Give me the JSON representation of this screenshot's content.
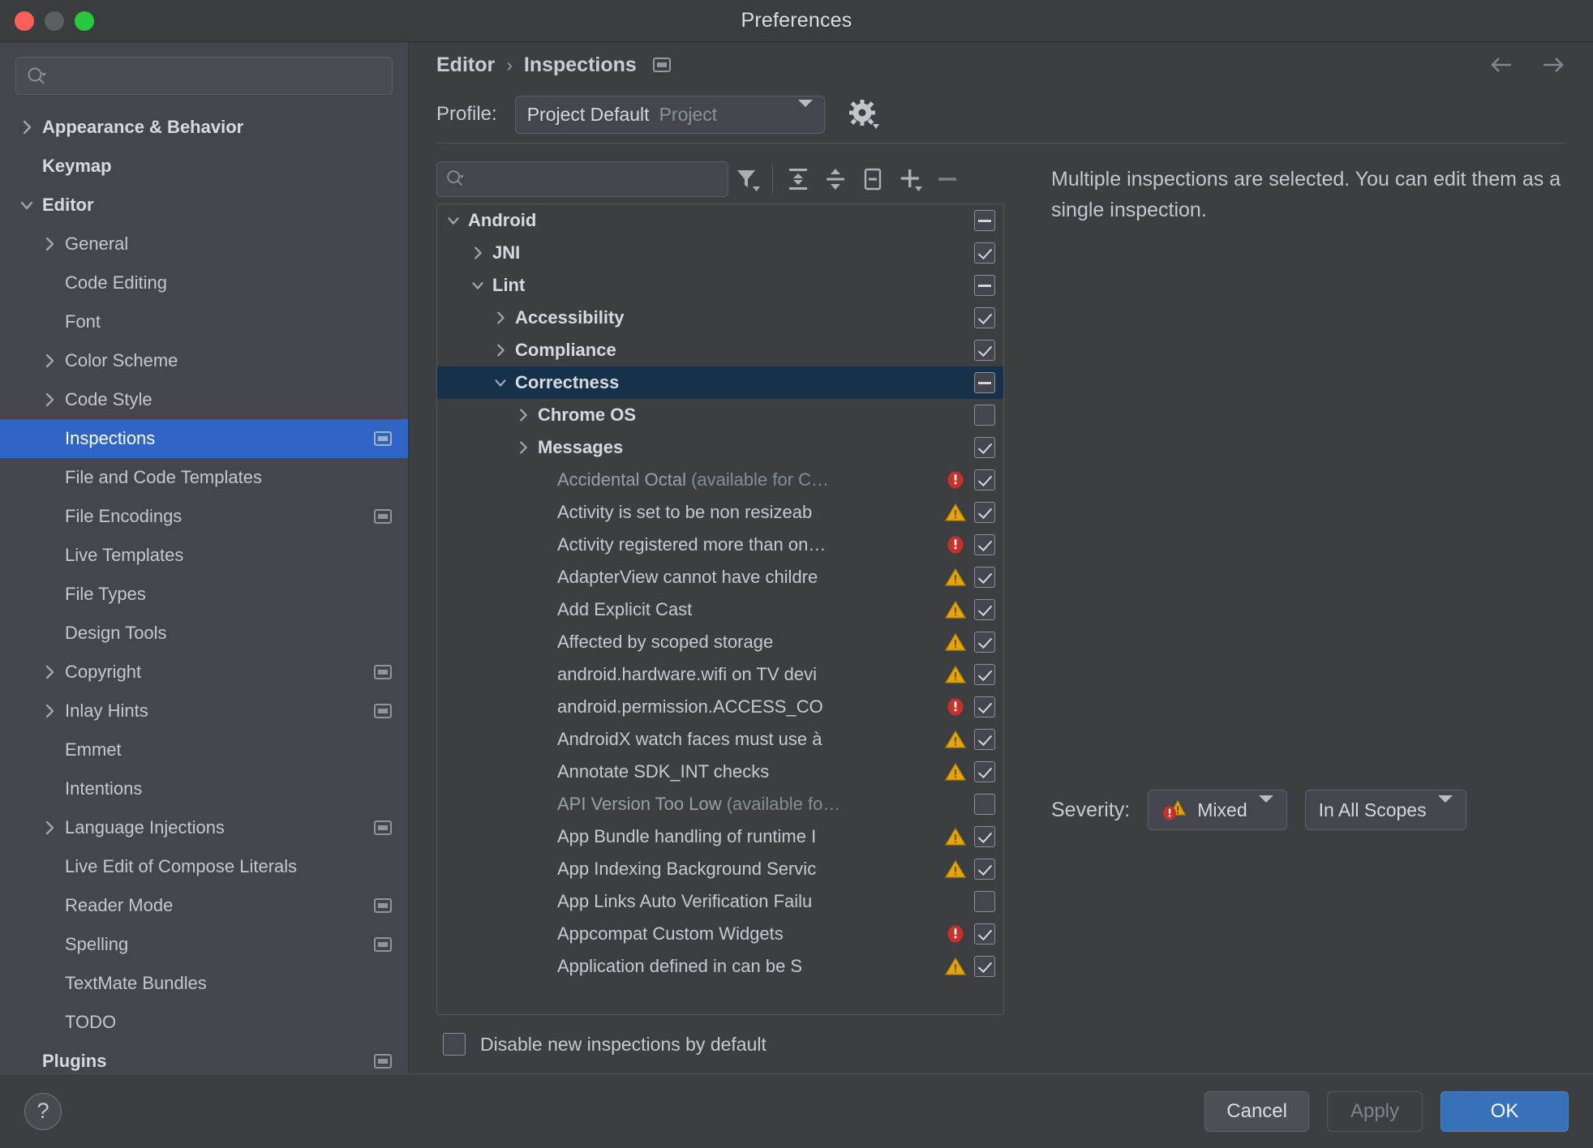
{
  "window": {
    "title": "Preferences",
    "traffic_lights": [
      "close-red",
      "minimize-yellow",
      "zoom-green"
    ]
  },
  "sidebar": {
    "search": {
      "value": "",
      "placeholder": ""
    },
    "items": [
      {
        "label": "Appearance & Behavior",
        "caret": "right",
        "level": 0,
        "bold": true,
        "badge": false,
        "selected": false
      },
      {
        "label": "Keymap",
        "caret": "none",
        "level": 0,
        "bold": true,
        "badge": false,
        "selected": false
      },
      {
        "label": "Editor",
        "caret": "down",
        "level": 0,
        "bold": true,
        "badge": false,
        "selected": false
      },
      {
        "label": "General",
        "caret": "right",
        "level": 1,
        "bold": false,
        "badge": false,
        "selected": false
      },
      {
        "label": "Code Editing",
        "caret": "none",
        "level": 1,
        "bold": false,
        "badge": false,
        "selected": false
      },
      {
        "label": "Font",
        "caret": "none",
        "level": 1,
        "bold": false,
        "badge": false,
        "selected": false
      },
      {
        "label": "Color Scheme",
        "caret": "right",
        "level": 1,
        "bold": false,
        "badge": false,
        "selected": false
      },
      {
        "label": "Code Style",
        "caret": "right",
        "level": 1,
        "bold": false,
        "badge": false,
        "selected": false
      },
      {
        "label": "Inspections",
        "caret": "none",
        "level": 1,
        "bold": false,
        "badge": true,
        "selected": true
      },
      {
        "label": "File and Code Templates",
        "caret": "none",
        "level": 1,
        "bold": false,
        "badge": false,
        "selected": false
      },
      {
        "label": "File Encodings",
        "caret": "none",
        "level": 1,
        "bold": false,
        "badge": true,
        "selected": false
      },
      {
        "label": "Live Templates",
        "caret": "none",
        "level": 1,
        "bold": false,
        "badge": false,
        "selected": false
      },
      {
        "label": "File Types",
        "caret": "none",
        "level": 1,
        "bold": false,
        "badge": false,
        "selected": false
      },
      {
        "label": "Design Tools",
        "caret": "none",
        "level": 1,
        "bold": false,
        "badge": false,
        "selected": false
      },
      {
        "label": "Copyright",
        "caret": "right",
        "level": 1,
        "bold": false,
        "badge": true,
        "selected": false
      },
      {
        "label": "Inlay Hints",
        "caret": "right",
        "level": 1,
        "bold": false,
        "badge": true,
        "selected": false
      },
      {
        "label": "Emmet",
        "caret": "none",
        "level": 1,
        "bold": false,
        "badge": false,
        "selected": false
      },
      {
        "label": "Intentions",
        "caret": "none",
        "level": 1,
        "bold": false,
        "badge": false,
        "selected": false
      },
      {
        "label": "Language Injections",
        "caret": "right",
        "level": 1,
        "bold": false,
        "badge": true,
        "selected": false
      },
      {
        "label": "Live Edit of Compose Literals",
        "caret": "none",
        "level": 1,
        "bold": false,
        "badge": false,
        "selected": false
      },
      {
        "label": "Reader Mode",
        "caret": "none",
        "level": 1,
        "bold": false,
        "badge": true,
        "selected": false
      },
      {
        "label": "Spelling",
        "caret": "none",
        "level": 1,
        "bold": false,
        "badge": true,
        "selected": false
      },
      {
        "label": "TextMate Bundles",
        "caret": "none",
        "level": 1,
        "bold": false,
        "badge": false,
        "selected": false
      },
      {
        "label": "TODO",
        "caret": "none",
        "level": 1,
        "bold": false,
        "badge": false,
        "selected": false
      },
      {
        "label": "Plugins",
        "caret": "none",
        "level": 0,
        "bold": true,
        "badge": true,
        "selected": false
      }
    ]
  },
  "header": {
    "breadcrumb": {
      "parent": "Editor",
      "separator": "›",
      "current": "Inspections"
    },
    "nav": {
      "back": "back-arrow",
      "forward": "forward-arrow"
    }
  },
  "profile": {
    "label": "Profile:",
    "value": "Project Default",
    "scope": "Project",
    "gear": "gear-icon"
  },
  "toolbar": {
    "search": {
      "value": "",
      "placeholder": ""
    },
    "buttons": [
      {
        "name": "filter-icon",
        "tooltip": "Filter inspections"
      },
      {
        "name": "expand-all-icon",
        "tooltip": "Expand All"
      },
      {
        "name": "collapse-all-icon",
        "tooltip": "Collapse All"
      },
      {
        "name": "reset-icon",
        "tooltip": "Reset to Defaults"
      },
      {
        "name": "add-icon",
        "tooltip": "Add"
      },
      {
        "name": "remove-icon",
        "tooltip": "Remove"
      }
    ]
  },
  "tree": {
    "rows": [
      {
        "label": "Android",
        "indent": 0,
        "caret": "down",
        "bold": true,
        "check": "partial",
        "severity": "none",
        "selected": false,
        "dim": false,
        "paren": ""
      },
      {
        "label": "JNI",
        "indent": 1,
        "caret": "right",
        "bold": true,
        "check": "checked",
        "severity": "none",
        "selected": false,
        "dim": false,
        "paren": ""
      },
      {
        "label": "Lint",
        "indent": 1,
        "caret": "down",
        "bold": true,
        "check": "partial",
        "severity": "none",
        "selected": false,
        "dim": false,
        "paren": ""
      },
      {
        "label": "Accessibility",
        "indent": 2,
        "caret": "right",
        "bold": true,
        "check": "checked",
        "severity": "none",
        "selected": false,
        "dim": false,
        "paren": ""
      },
      {
        "label": "Compliance",
        "indent": 2,
        "caret": "right",
        "bold": true,
        "check": "checked",
        "severity": "none",
        "selected": false,
        "dim": false,
        "paren": ""
      },
      {
        "label": "Correctness",
        "indent": 2,
        "caret": "down",
        "bold": true,
        "check": "partial",
        "severity": "none",
        "selected": true,
        "dim": false,
        "paren": ""
      },
      {
        "label": "Chrome OS",
        "indent": 3,
        "caret": "right",
        "bold": true,
        "check": "empty",
        "severity": "none",
        "selected": false,
        "dim": false,
        "paren": ""
      },
      {
        "label": "Messages",
        "indent": 3,
        "caret": "right",
        "bold": true,
        "check": "checked",
        "severity": "none",
        "selected": false,
        "dim": false,
        "paren": ""
      },
      {
        "label": "Accidental Octal",
        "indent": 4,
        "caret": "none",
        "bold": false,
        "check": "checked",
        "severity": "error",
        "selected": false,
        "dim": true,
        "paren": " (available for C…"
      },
      {
        "label": "Activity is set to be non resizeab",
        "indent": 4,
        "caret": "none",
        "bold": false,
        "check": "checked",
        "severity": "warning",
        "selected": false,
        "dim": false,
        "paren": ""
      },
      {
        "label": "Activity registered more than on…",
        "indent": 4,
        "caret": "none",
        "bold": false,
        "check": "checked",
        "severity": "error",
        "selected": false,
        "dim": false,
        "paren": ""
      },
      {
        "label": "AdapterView cannot have childre",
        "indent": 4,
        "caret": "none",
        "bold": false,
        "check": "checked",
        "severity": "warning",
        "selected": false,
        "dim": false,
        "paren": ""
      },
      {
        "label": "Add Explicit Cast",
        "indent": 4,
        "caret": "none",
        "bold": false,
        "check": "checked",
        "severity": "warning",
        "selected": false,
        "dim": false,
        "paren": ""
      },
      {
        "label": "Affected by scoped storage",
        "indent": 4,
        "caret": "none",
        "bold": false,
        "check": "checked",
        "severity": "warning",
        "selected": false,
        "dim": false,
        "paren": ""
      },
      {
        "label": "android.hardware.wifi on TV devi",
        "indent": 4,
        "caret": "none",
        "bold": false,
        "check": "checked",
        "severity": "warning",
        "selected": false,
        "dim": false,
        "paren": ""
      },
      {
        "label": "android.permission.ACCESS_CO",
        "indent": 4,
        "caret": "none",
        "bold": false,
        "check": "checked",
        "severity": "error",
        "selected": false,
        "dim": false,
        "paren": ""
      },
      {
        "label": "AndroidX watch faces must use à",
        "indent": 4,
        "caret": "none",
        "bold": false,
        "check": "checked",
        "severity": "warning",
        "selected": false,
        "dim": false,
        "paren": ""
      },
      {
        "label": "Annotate SDK_INT checks",
        "indent": 4,
        "caret": "none",
        "bold": false,
        "check": "checked",
        "severity": "warning",
        "selected": false,
        "dim": false,
        "paren": ""
      },
      {
        "label": "API Version Too Low",
        "indent": 4,
        "caret": "none",
        "bold": false,
        "check": "empty",
        "severity": "none",
        "selected": false,
        "dim": true,
        "paren": " (available fo…"
      },
      {
        "label": "App Bundle handling of runtime I",
        "indent": 4,
        "caret": "none",
        "bold": false,
        "check": "checked",
        "severity": "warning",
        "selected": false,
        "dim": false,
        "paren": ""
      },
      {
        "label": "App Indexing Background Servic",
        "indent": 4,
        "caret": "none",
        "bold": false,
        "check": "checked",
        "severity": "warning",
        "selected": false,
        "dim": false,
        "paren": ""
      },
      {
        "label": "App Links Auto Verification Failu",
        "indent": 4,
        "caret": "none",
        "bold": false,
        "check": "empty",
        "severity": "none",
        "selected": false,
        "dim": false,
        "paren": ""
      },
      {
        "label": "Appcompat Custom Widgets",
        "indent": 4,
        "caret": "none",
        "bold": false,
        "check": "checked",
        "severity": "error",
        "selected": false,
        "dim": false,
        "paren": ""
      },
      {
        "label": "Application defined in can be S",
        "indent": 4,
        "caret": "none",
        "bold": false,
        "check": "checked",
        "severity": "warning",
        "selected": false,
        "dim": false,
        "paren": ""
      }
    ],
    "footer_checkbox": {
      "label": "Disable new inspections by default",
      "checked": false
    }
  },
  "details": {
    "message": "Multiple inspections are selected. You can edit them as a single inspection.",
    "severity_label": "Severity:",
    "severity_value": "Mixed",
    "severity_icon": "mixed-severity-icon",
    "scope_value": "In All Scopes"
  },
  "footer": {
    "help": "?",
    "cancel": "Cancel",
    "apply": "Apply",
    "ok": "OK"
  },
  "colors": {
    "accent_selection": "#2f65c7",
    "tree_selection": "#16314a",
    "ok_button": "#3771ba",
    "error": "#c9302c",
    "warning": "#e5a50a",
    "window_bg": "#3c3f41",
    "sidebar_bg": "#43474d"
  }
}
